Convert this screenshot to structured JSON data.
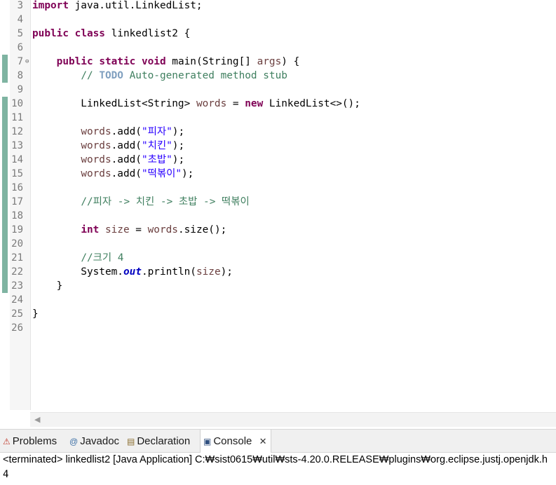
{
  "editor": {
    "line_numbers": [
      "3",
      "4",
      "5",
      "6",
      "7",
      "8",
      "9",
      "10",
      "11",
      "12",
      "13",
      "14",
      "15",
      "16",
      "17",
      "18",
      "19",
      "20",
      "21",
      "22",
      "23",
      "24",
      "25",
      "26"
    ],
    "lines": [
      [
        [
          "kw",
          "import"
        ],
        [
          "t",
          " java.util.LinkedList;"
        ]
      ],
      [],
      [
        [
          "kw",
          "public"
        ],
        [
          "t",
          " "
        ],
        [
          "kw",
          "class"
        ],
        [
          "t",
          " linkedlist2 {"
        ]
      ],
      [],
      [
        [
          "t",
          "    "
        ],
        [
          "kw",
          "public"
        ],
        [
          "t",
          " "
        ],
        [
          "kw",
          "static"
        ],
        [
          "t",
          " "
        ],
        [
          "kw",
          "void"
        ],
        [
          "t",
          " main(String[] "
        ],
        [
          "var",
          "args"
        ],
        [
          "t",
          ") {"
        ]
      ],
      [
        [
          "t",
          "        "
        ],
        [
          "cm",
          "// "
        ],
        [
          "todo",
          "TODO"
        ],
        [
          "cm",
          " Auto-generated method stub"
        ]
      ],
      [],
      [
        [
          "t",
          "        LinkedList<String> "
        ],
        [
          "var",
          "words"
        ],
        [
          "t",
          " = "
        ],
        [
          "kw",
          "new"
        ],
        [
          "t",
          " LinkedList<>();"
        ]
      ],
      [],
      [
        [
          "t",
          "        "
        ],
        [
          "var",
          "words"
        ],
        [
          "t",
          ".add("
        ],
        [
          "str",
          "\"피자\""
        ],
        [
          "t",
          ");"
        ]
      ],
      [
        [
          "t",
          "        "
        ],
        [
          "var",
          "words"
        ],
        [
          "t",
          ".add("
        ],
        [
          "str",
          "\"치킨\""
        ],
        [
          "t",
          ");"
        ]
      ],
      [
        [
          "t",
          "        "
        ],
        [
          "var",
          "words"
        ],
        [
          "t",
          ".add("
        ],
        [
          "str",
          "\"초밥\""
        ],
        [
          "t",
          ");"
        ]
      ],
      [
        [
          "t",
          "        "
        ],
        [
          "var",
          "words"
        ],
        [
          "t",
          ".add("
        ],
        [
          "str",
          "\"떡볶이\""
        ],
        [
          "t",
          ");"
        ]
      ],
      [],
      [
        [
          "t",
          "        "
        ],
        [
          "cm",
          "//피자 -> 치킨 -> 초밥 -> 떡볶이"
        ]
      ],
      [],
      [
        [
          "t",
          "        "
        ],
        [
          "kw",
          "int"
        ],
        [
          "t",
          " "
        ],
        [
          "var",
          "size"
        ],
        [
          "t",
          " = "
        ],
        [
          "var",
          "words"
        ],
        [
          "t",
          ".size();"
        ]
      ],
      [],
      [
        [
          "t",
          "        "
        ],
        [
          "cm",
          "//크기 4"
        ]
      ],
      [
        [
          "t",
          "        System."
        ],
        [
          "fld",
          "out"
        ],
        [
          "t",
          ".println("
        ],
        [
          "var",
          "size"
        ],
        [
          "t",
          ");"
        ]
      ],
      [
        [
          "t",
          "    }"
        ]
      ],
      [],
      [
        [
          "t",
          "}"
        ]
      ],
      []
    ]
  },
  "console": {
    "tabs": [
      {
        "label": "Problems",
        "icon": "problems-icon",
        "glyph": "⚠",
        "color": "#c0392b"
      },
      {
        "label": "Javadoc",
        "icon": "javadoc-icon",
        "glyph": "@",
        "color": "#3a6ea5"
      },
      {
        "label": "Declaration",
        "icon": "declaration-icon",
        "glyph": "▤",
        "color": "#8a6d2e"
      },
      {
        "label": "Console",
        "icon": "console-icon",
        "glyph": "▣",
        "color": "#2f4f7f"
      }
    ],
    "close_glyph": "✕",
    "terminated_text": "<terminated> linkedlist2 [Java Application] C:₩sist0615₩util₩sts-4.20.0.RELEASE₩plugins₩org.eclipse.justj.openjdk.h",
    "output": "4"
  }
}
